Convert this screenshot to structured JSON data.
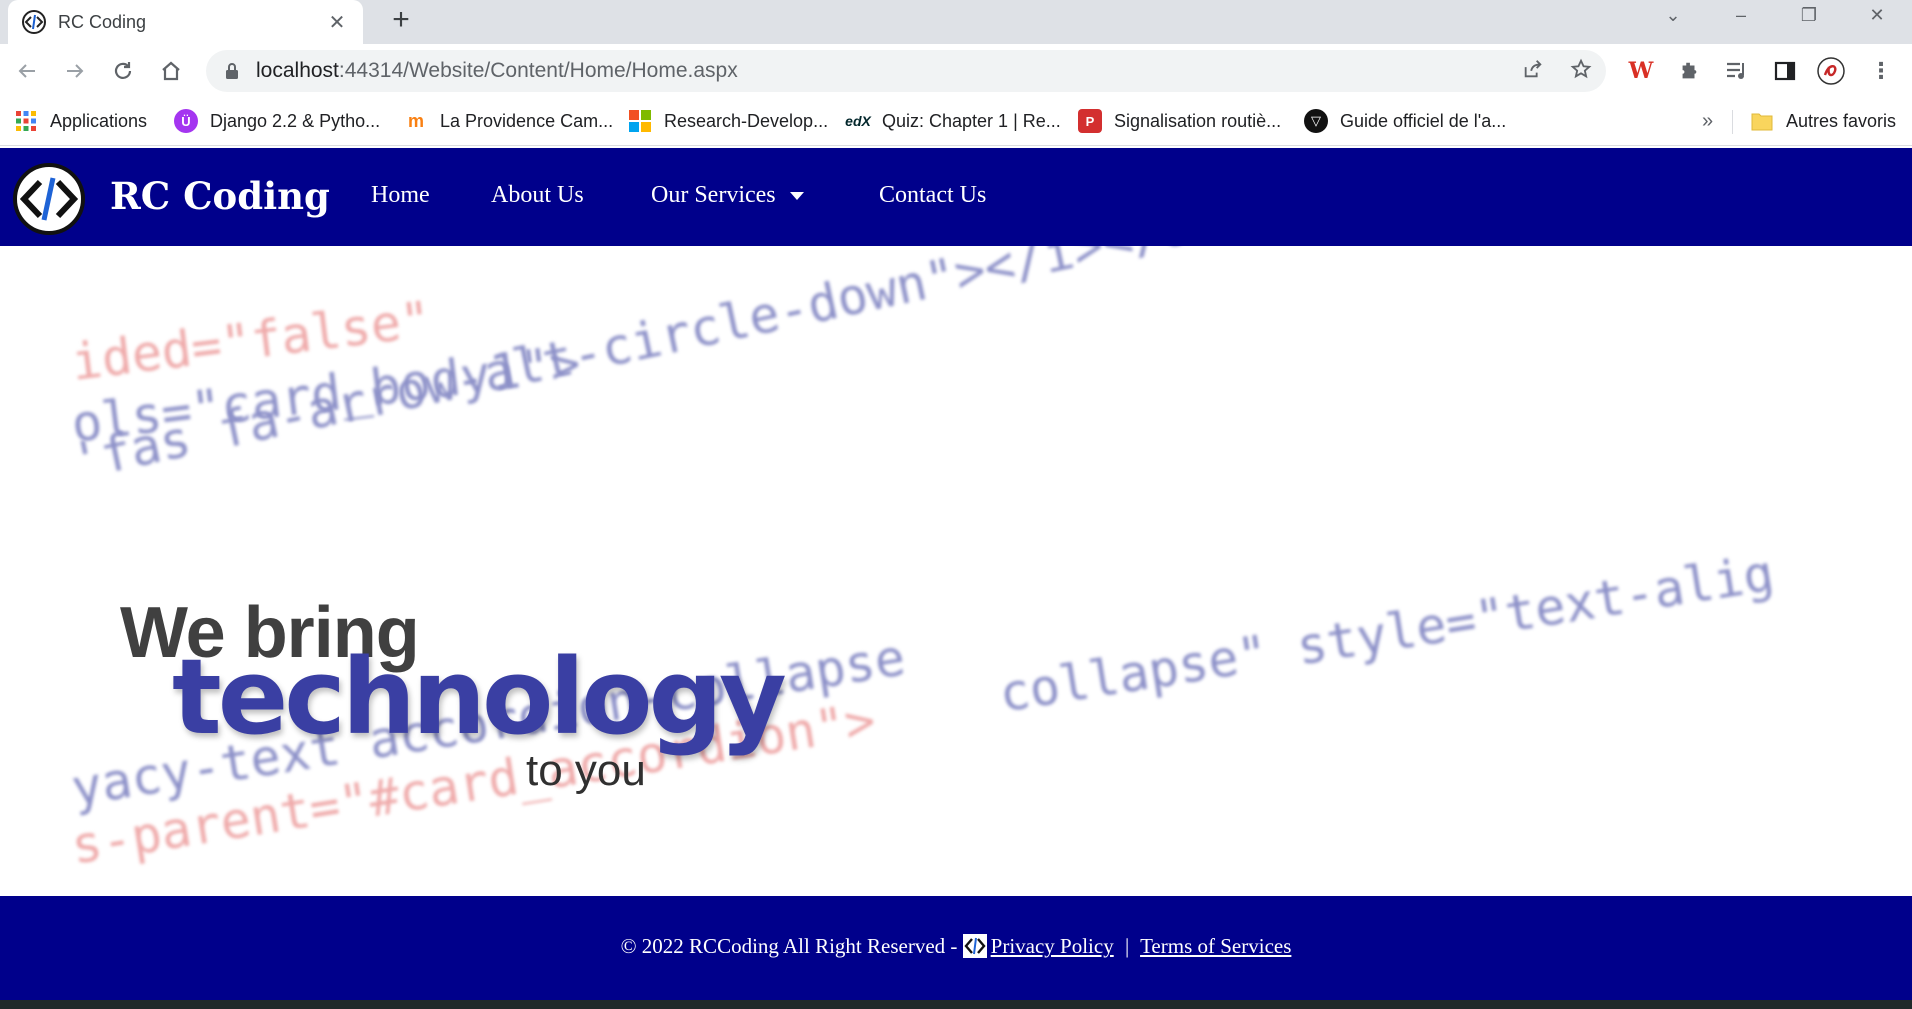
{
  "browser": {
    "tab_title": "RC Coding",
    "new_tab_symbol": "+",
    "url_host": "localhost",
    "url_rest": ":44314/Website/Content/Home/Home.aspx",
    "bookmarks": [
      {
        "label": "Applications",
        "icon": "apps-grid-icon"
      },
      {
        "label": "Django 2.2 & Pytho...",
        "icon": "udemy-icon"
      },
      {
        "label": "La Providence Cam...",
        "icon": "moodle-icon"
      },
      {
        "label": "Research-Develop...",
        "icon": "microsoft-icon"
      },
      {
        "label": "Quiz: Chapter 1 | Re...",
        "icon": "edx-icon"
      },
      {
        "label": "Signalisation routiè...",
        "icon": "p-icon"
      },
      {
        "label": "Guide officiel de l'a...",
        "icon": "shield-icon"
      }
    ],
    "bookmarks_overflow": "»",
    "other_bookmarks": "Autres favoris",
    "accent_color": "#1a73e8"
  },
  "site": {
    "brand": "RC Coding",
    "nav": {
      "home": "Home",
      "about": "About Us",
      "services": "Our Services",
      "contact": "Contact Us"
    },
    "brand_color": "#00008b",
    "hero": {
      "line_top": "We bring",
      "line_main": "technology",
      "line_bottom": "to you",
      "code_lines": [
        "ided=\"false\"",
        "ols=\"card_body1\">",
        "'fas fa-arrow-alt-circle-down\"></i></a>",
        "collapse\" style=\"text-alig",
        "yacy-text accordion-collapse",
        "s-parent=\"#card_accordion\">"
      ]
    },
    "footer": {
      "copyright": "© 2022 RCCoding All Right Reserved - ",
      "privacy": "Privacy Policy",
      "separator": "|",
      "terms": "Terms of Services"
    }
  }
}
